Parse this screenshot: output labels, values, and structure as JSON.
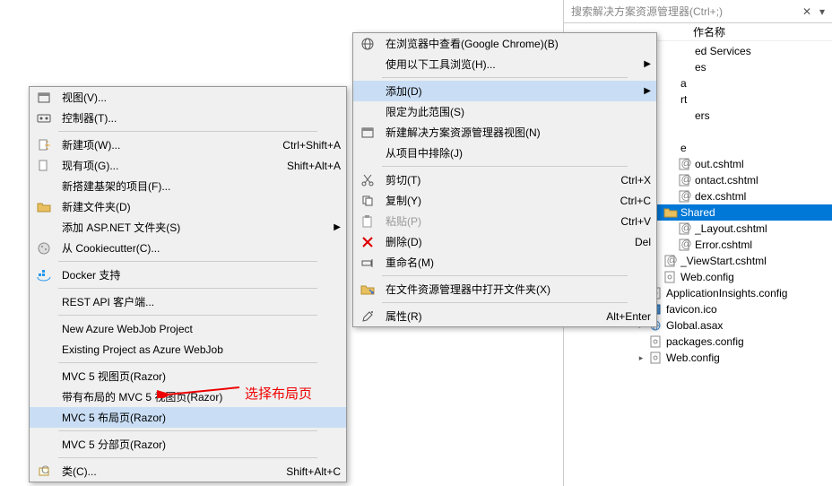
{
  "menu1": {
    "items": [
      {
        "label": "视图(V)...",
        "icon": "view-icon"
      },
      {
        "label": "控制器(T)...",
        "icon": "controller-icon"
      },
      {
        "sep": true
      },
      {
        "label": "新建项(W)...",
        "icon": "new-item-icon",
        "shortcut": "Ctrl+Shift+A"
      },
      {
        "label": "现有项(G)...",
        "icon": "existing-item-icon",
        "shortcut": "Shift+Alt+A"
      },
      {
        "label": "新搭建基架的项目(F)..."
      },
      {
        "label": "新建文件夹(D)",
        "icon": "folder-icon"
      },
      {
        "label": "添加 ASP.NET 文件夹(S)",
        "arrow": true
      },
      {
        "label": "从 Cookiecutter(C)...",
        "icon": "cookie-icon"
      },
      {
        "sep": true
      },
      {
        "label": "Docker 支持",
        "icon": "docker-icon"
      },
      {
        "sep": true
      },
      {
        "label": "REST API 客户端..."
      },
      {
        "sep": true
      },
      {
        "label": "New Azure WebJob Project"
      },
      {
        "label": "Existing Project as Azure WebJob"
      },
      {
        "sep": true
      },
      {
        "label": "MVC 5 视图页(Razor)"
      },
      {
        "label": "带有布局的 MVC 5 视图页(Razor)"
      },
      {
        "label": "MVC 5 布局页(Razor)",
        "highlighted": true
      },
      {
        "sep": true
      },
      {
        "label": "MVC 5 分部页(Razor)"
      },
      {
        "sep": true
      },
      {
        "label": "类(C)...",
        "icon": "class-icon",
        "shortcut": "Shift+Alt+C"
      }
    ]
  },
  "menu2": {
    "items": [
      {
        "label": "在浏览器中查看(Google Chrome)(B)",
        "icon": "browser-icon"
      },
      {
        "label": "使用以下工具浏览(H)...",
        "arrow": true
      },
      {
        "sep": true
      },
      {
        "label": "添加(D)",
        "highlighted": true,
        "arrow": true
      },
      {
        "label": "限定为此范围(S)"
      },
      {
        "label": "新建解决方案资源管理器视图(N)",
        "icon": "view-icon"
      },
      {
        "label": "从项目中排除(J)"
      },
      {
        "sep": true
      },
      {
        "label": "剪切(T)",
        "icon": "cut-icon",
        "shortcut": "Ctrl+X"
      },
      {
        "label": "复制(Y)",
        "icon": "copy-icon",
        "shortcut": "Ctrl+C"
      },
      {
        "label": "粘贴(P)",
        "icon": "paste-icon",
        "shortcut": "Ctrl+V",
        "disabled": true
      },
      {
        "label": "删除(D)",
        "icon": "delete-icon",
        "shortcut": "Del"
      },
      {
        "label": "重命名(M)",
        "icon": "rename-icon"
      },
      {
        "sep": true
      },
      {
        "label": "在文件资源管理器中打开文件夹(X)",
        "icon": "open-folder-icon"
      },
      {
        "sep": true
      },
      {
        "label": "属性(R)",
        "icon": "properties-icon",
        "shortcut": "Alt+Enter"
      }
    ]
  },
  "annotation": "选择布局页",
  "search": {
    "placeholder": "搜索解决方案资源管理器(Ctrl+;)"
  },
  "panel_header": "作名称",
  "tree": [
    {
      "lvl": 1,
      "label": "ed Services",
      "toggle": ""
    },
    {
      "lvl": 1,
      "label": "es",
      "toggle": ""
    },
    {
      "lvl": 0,
      "label": "a",
      "toggle": ""
    },
    {
      "lvl": 0,
      "label": "rt",
      "toggle": ""
    },
    {
      "lvl": 1,
      "label": "ers",
      "toggle": ""
    },
    {
      "lvl": 0,
      "label": "",
      "toggle": ""
    },
    {
      "lvl": 0,
      "label": "e",
      "toggle": ""
    },
    {
      "lvl": 1,
      "label": "out.cshtml",
      "toggle": "",
      "icon": "cshtml"
    },
    {
      "lvl": 1,
      "label": "ontact.cshtml",
      "toggle": "",
      "icon": "cshtml"
    },
    {
      "lvl": 1,
      "label": "dex.cshtml",
      "toggle": "",
      "icon": "cshtml"
    },
    {
      "lvl": 0,
      "label": "Shared",
      "toggle": "▴",
      "selected": true,
      "icon": "folder"
    },
    {
      "lvl": 1,
      "label": "_Layout.cshtml",
      "toggle": "",
      "icon": "cshtml"
    },
    {
      "lvl": 1,
      "label": "Error.cshtml",
      "toggle": "",
      "icon": "cshtml"
    },
    {
      "lvl": 0,
      "label": "_ViewStart.cshtml",
      "toggle": "",
      "icon": "cshtml"
    },
    {
      "lvl": 0,
      "label": "Web.config",
      "toggle": "▸",
      "icon": "config"
    },
    {
      "lvl": -1,
      "label": "ApplicationInsights.config",
      "toggle": "▸",
      "icon": "config"
    },
    {
      "lvl": -1,
      "label": "favicon.ico",
      "toggle": "",
      "icon": "ico"
    },
    {
      "lvl": -1,
      "label": "Global.asax",
      "toggle": "▸",
      "icon": "globe"
    },
    {
      "lvl": -1,
      "label": "packages.config",
      "toggle": "",
      "icon": "config"
    },
    {
      "lvl": -1,
      "label": "Web.config",
      "toggle": "▸",
      "icon": "config"
    }
  ]
}
